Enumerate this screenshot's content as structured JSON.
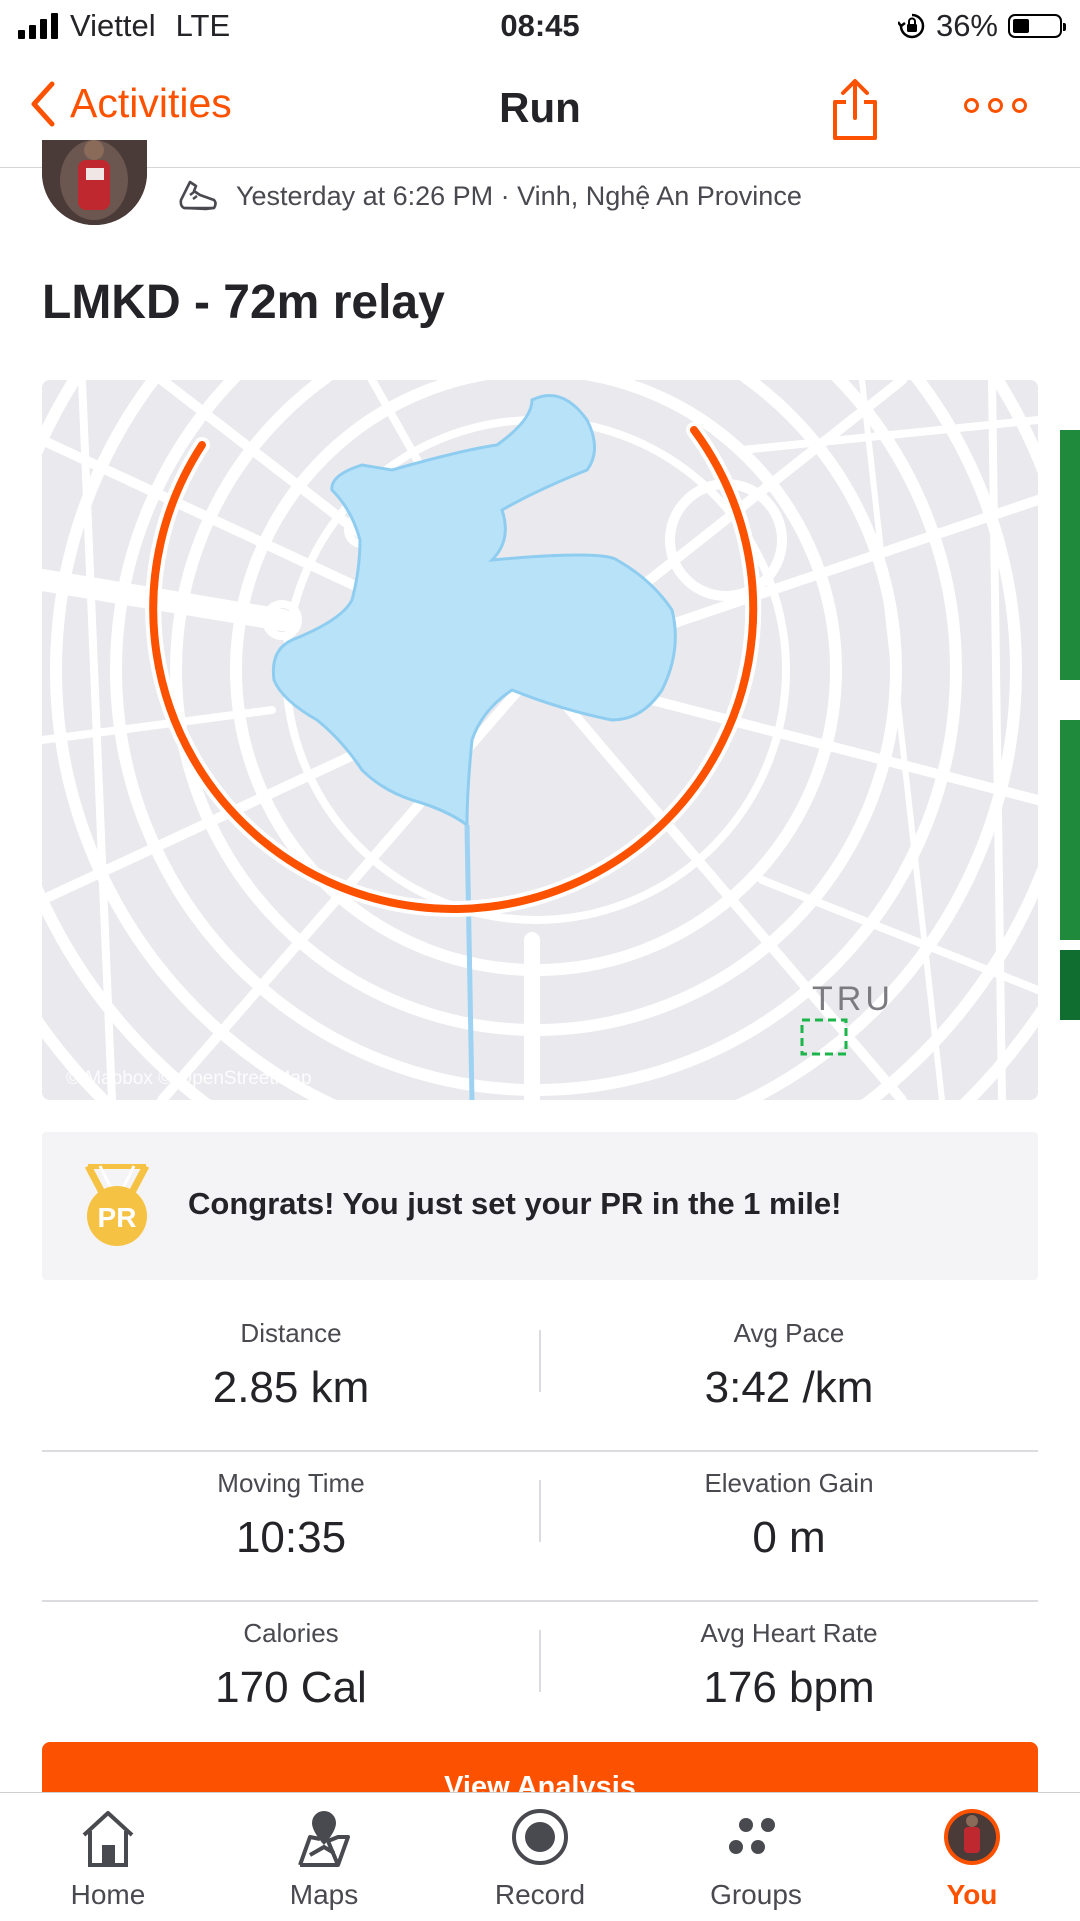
{
  "status_bar": {
    "carrier": "Viettel",
    "network": "LTE",
    "time": "08:45",
    "battery": "36%"
  },
  "nav": {
    "back_label": "Activities",
    "title": "Run",
    "share_icon": "share-icon",
    "more_icon": "more-icon"
  },
  "activity": {
    "meta": "Yesterday at 6:26 PM · Vinh, Nghệ An Province",
    "title": "LMKD - 72m relay"
  },
  "map": {
    "attribution": "© Mapbox © OpenStreetMap",
    "label_fragment": "TRU",
    "route_color": "#fc5200",
    "water_color": "#b8e2f8"
  },
  "achievement": {
    "medal_text": "PR",
    "message": "Congrats! You just set your PR in the 1 mile!"
  },
  "stats": [
    {
      "label": "Distance",
      "value": "2.85 km"
    },
    {
      "label": "Avg Pace",
      "value": "3:42 /km"
    },
    {
      "label": "Moving Time",
      "value": "10:35"
    },
    {
      "label": "Elevation Gain",
      "value": "0 m"
    },
    {
      "label": "Calories",
      "value": "170 Cal"
    },
    {
      "label": "Avg Heart Rate",
      "value": "176 bpm"
    }
  ],
  "analysis_button": "View Analysis",
  "tabs": [
    {
      "label": "Home",
      "icon": "home-icon"
    },
    {
      "label": "Maps",
      "icon": "maps-icon"
    },
    {
      "label": "Record",
      "icon": "record-icon"
    },
    {
      "label": "Groups",
      "icon": "groups-icon"
    },
    {
      "label": "You",
      "icon": "avatar-icon",
      "active": true
    }
  ],
  "colors": {
    "accent": "#fc5200",
    "text": "#242428",
    "secondary_text": "#494950",
    "banner_bg": "#f4f4f6",
    "medal": "#f6c244"
  }
}
